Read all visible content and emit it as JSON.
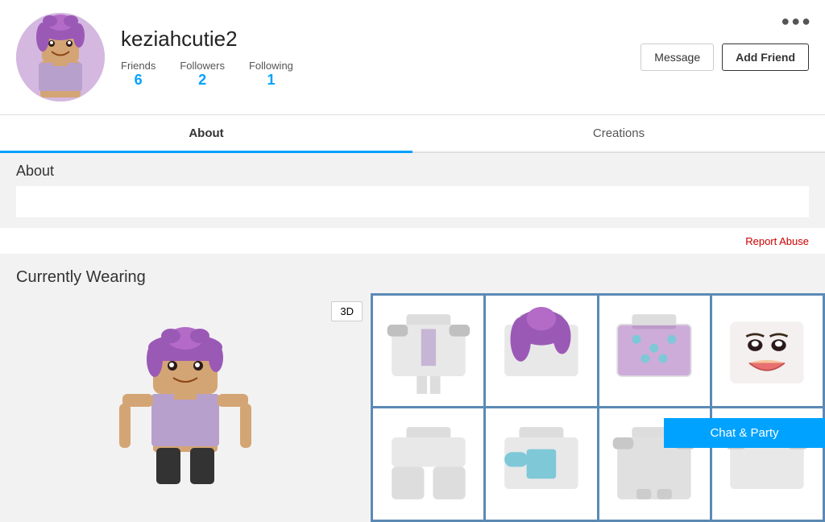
{
  "profile": {
    "username": "keziahcutie2",
    "friends_label": "Friends",
    "friends_count": "6",
    "followers_label": "Followers",
    "followers_count": "2",
    "following_label": "Following",
    "following_count": "1",
    "message_btn": "Message",
    "add_friend_btn": "Add Friend",
    "three_dots": "●●●"
  },
  "tabs": [
    {
      "id": "about",
      "label": "About",
      "active": true
    },
    {
      "id": "creations",
      "label": "Creations",
      "active": false
    }
  ],
  "about": {
    "title": "About",
    "report_abuse_label": "Report Abuse"
  },
  "currently_wearing": {
    "title": "Currently Wearing",
    "btn_3d": "3D"
  },
  "items": [
    {
      "id": 1,
      "type": "shirt",
      "color": "#c0c0c0"
    },
    {
      "id": 2,
      "type": "hair",
      "color": "#9b59b6"
    },
    {
      "id": 3,
      "type": "shirt-pattern",
      "color": "#9b59b6"
    },
    {
      "id": 4,
      "type": "face",
      "color": "#f5c6a0"
    },
    {
      "id": 5,
      "type": "pants",
      "color": "#c0c0c0"
    },
    {
      "id": 6,
      "type": "accessory",
      "color": "#7ec8d8"
    },
    {
      "id": 7,
      "type": "body",
      "color": "#c0c0c0"
    },
    {
      "id": 8,
      "type": "extra",
      "color": "#c0c0c0"
    }
  ],
  "chat_party": {
    "label": "Chat & Party"
  }
}
